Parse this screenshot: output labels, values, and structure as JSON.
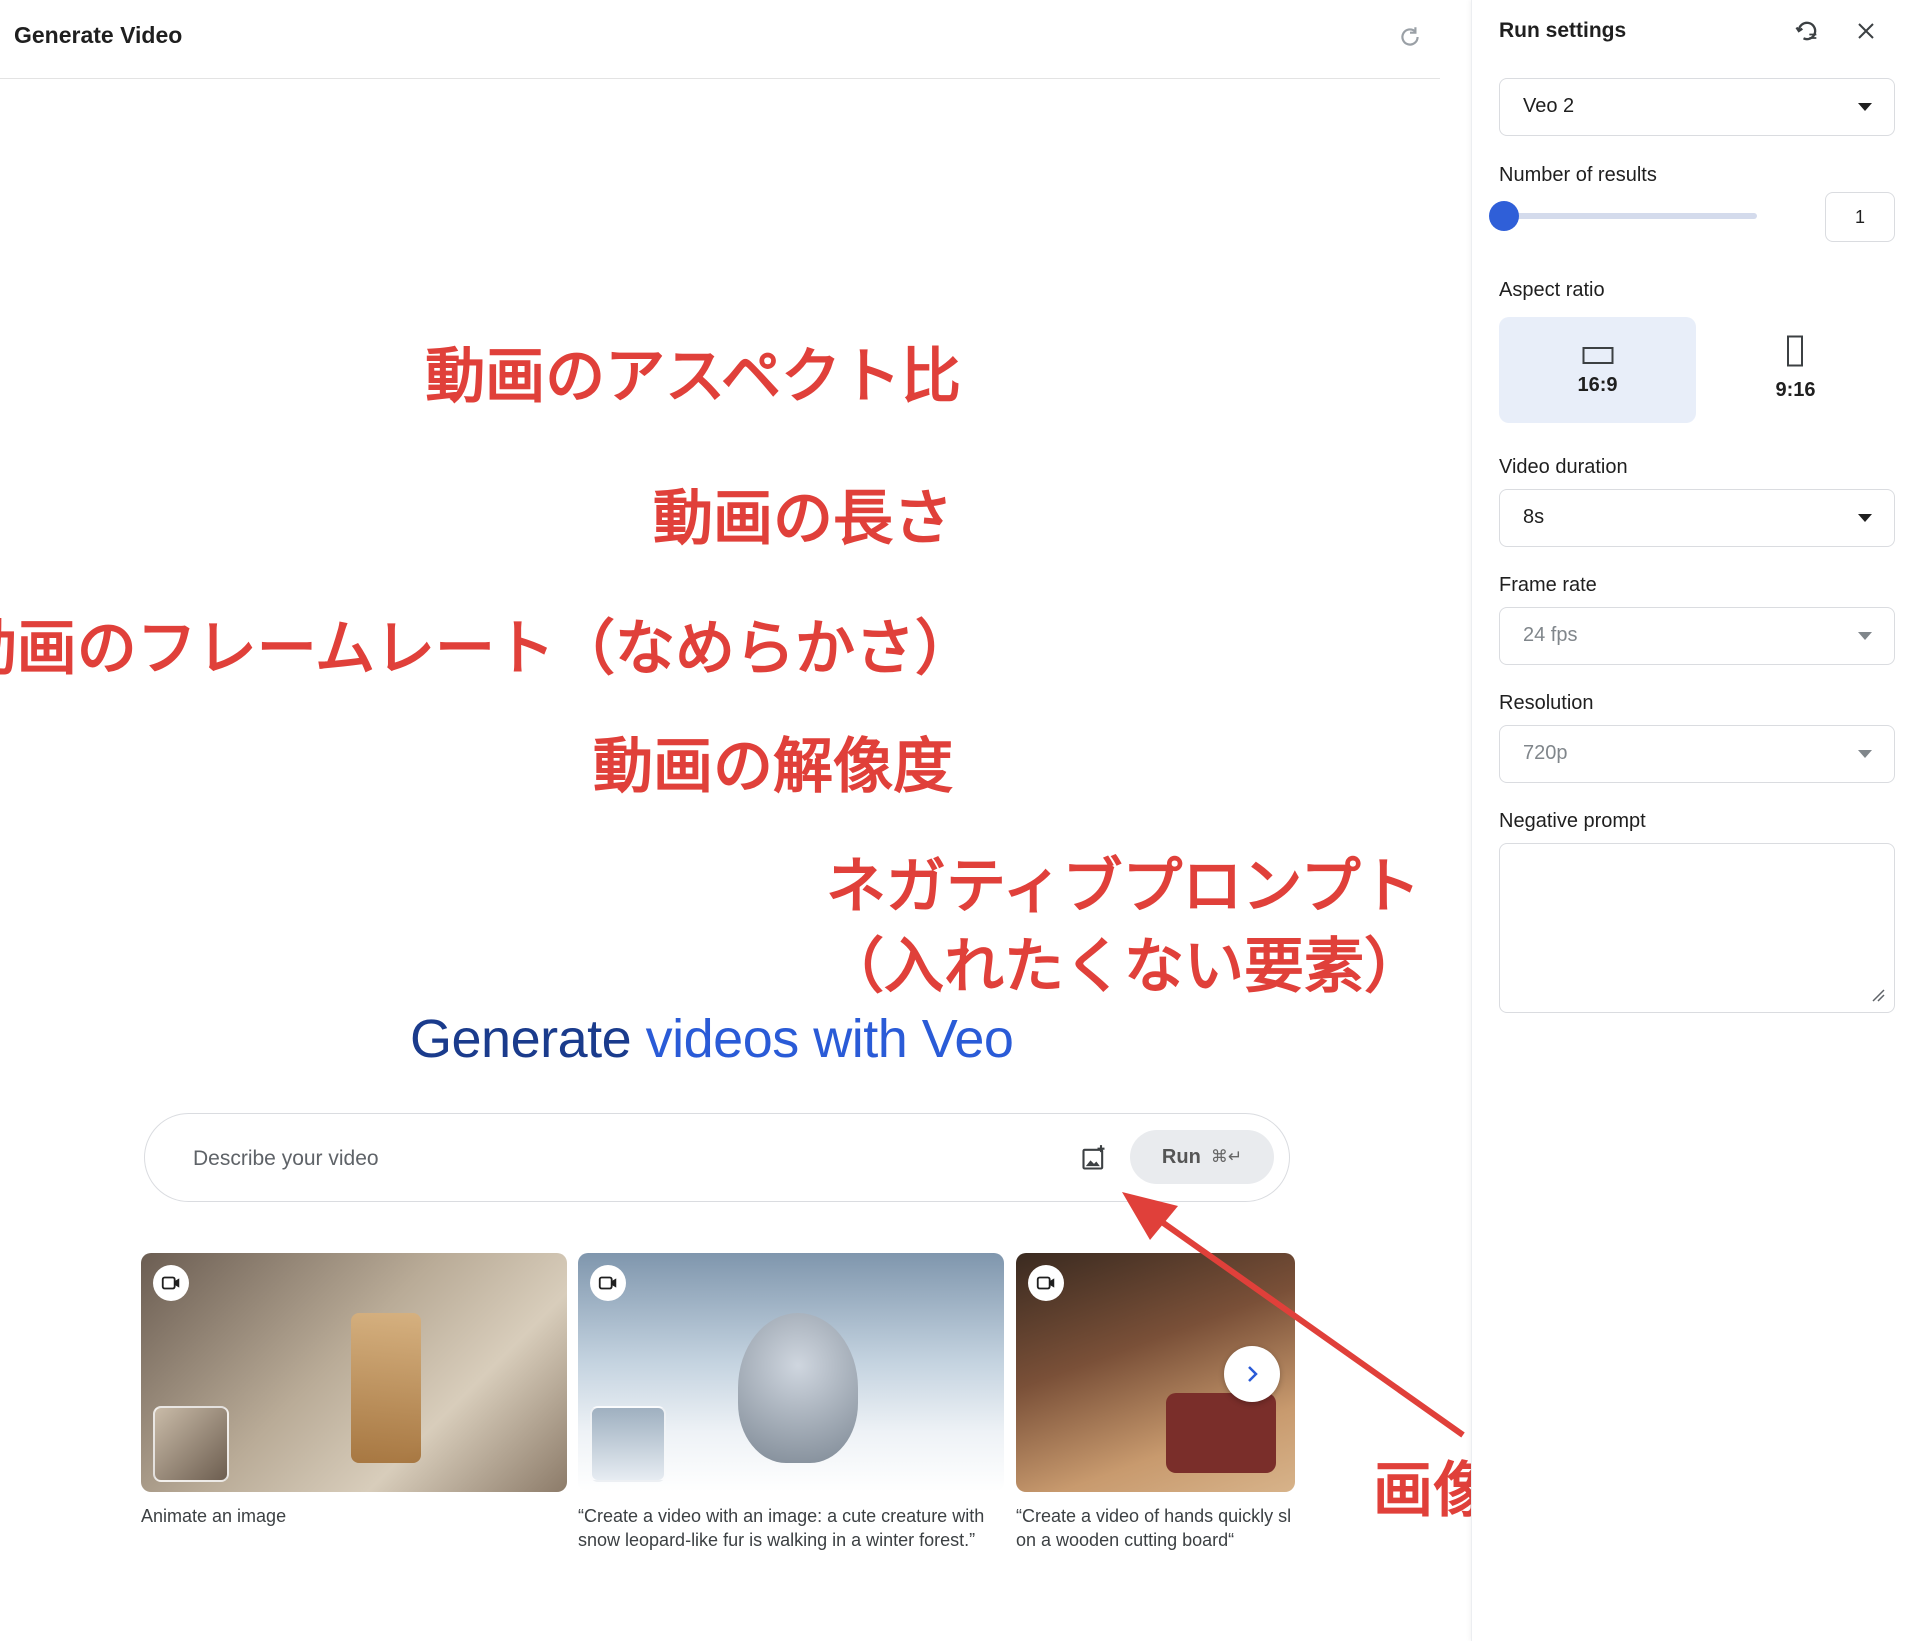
{
  "header": {
    "title": "Generate Video",
    "refresh_icon": "refresh-icon"
  },
  "hero": {
    "title_part1": "Generate ",
    "title_part2": "videos with ",
    "title_part3": "Veo"
  },
  "prompt": {
    "placeholder": "Describe your video",
    "add_image_icon": "add-photo-icon",
    "run_label": "Run",
    "run_shortcut": "⌘↵"
  },
  "examples": [
    {
      "caption": "Animate an image",
      "icon": "video-camera-icon",
      "colors": [
        "#8a7a6a",
        "#cfc3b2"
      ]
    },
    {
      "caption": "“Create a video with an image: a cute creature with snow leopard-like fur is walking in a winter forest.”",
      "caption_line1": "“Create a video with an image: a cute creature with",
      "caption_line2": "snow leopard-like fur is walking in a winter forest.”",
      "icon": "video-camera-icon",
      "colors": [
        "#9fb4c8",
        "#eef2f6"
      ]
    },
    {
      "caption_line1": "“Create a video of hands quickly sl",
      "caption_line2": "on a wooden cutting board“",
      "icon": "video-camera-icon",
      "colors": [
        "#7a5038",
        "#c89a6e"
      ]
    }
  ],
  "carousel": {
    "next_icon": "chevron-right-icon"
  },
  "settings": {
    "title": "Run settings",
    "model": {
      "value": "Veo 2"
    },
    "results": {
      "label": "Number of results",
      "value": "1",
      "fraction": 0.0
    },
    "aspect_ratio": {
      "label": "Aspect ratio",
      "options": [
        "16:9",
        "9:16"
      ],
      "selected": "16:9"
    },
    "duration": {
      "label": "Video duration",
      "value": "8s"
    },
    "frame_rate": {
      "label": "Frame rate",
      "value": "24 fps"
    },
    "resolution": {
      "label": "Resolution",
      "value": "720p"
    },
    "negative_prompt": {
      "label": "Negative prompt",
      "value": ""
    }
  },
  "annotations": {
    "aspect": "動画のアスペクト比",
    "duration": "動画の長さ",
    "frame_rate": "動画のフレームレート（なめらかさ）",
    "resolution": "動画の解像度",
    "negative_line1": "ネガティブプロンプト",
    "negative_line2": "（入れたくない要素）",
    "image": "画像を提供可能"
  },
  "colors": {
    "accent": "#2f5fd8",
    "annotation": "#e0403a",
    "hero_dark": "#1a3b8c"
  }
}
